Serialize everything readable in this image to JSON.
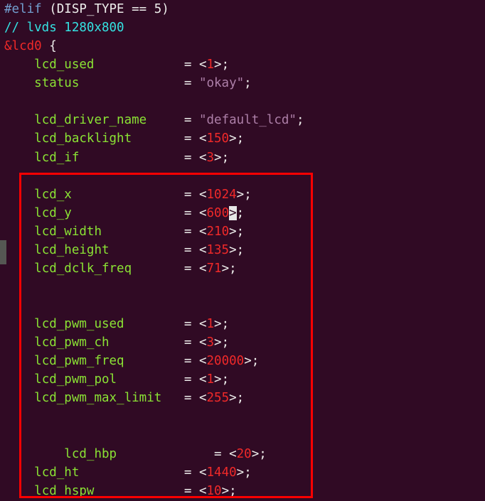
{
  "lines": [
    {
      "type": "directive",
      "key": "#elif",
      "cond": "(DISP_TYPE == 5)"
    },
    {
      "type": "comment",
      "text": "// lvds 1280x800"
    },
    {
      "type": "node",
      "node": "&lcd0",
      "tail": " {"
    },
    {
      "type": "propspace",
      "indent": "    ",
      "prop": "lcd_used",
      "padto": 24,
      "val": "1"
    },
    {
      "type": "propstr",
      "indent": "    ",
      "prop": "status",
      "padto": 24,
      "str": "\"okay\""
    },
    {
      "type": "blank"
    },
    {
      "type": "propstr",
      "indent": "    ",
      "prop": "lcd_driver_name",
      "padto": 24,
      "str": "\"default_lcd\""
    },
    {
      "type": "propspace",
      "indent": "    ",
      "prop": "lcd_backlight",
      "padto": 24,
      "val": "150"
    },
    {
      "type": "propspace",
      "indent": "    ",
      "prop": "lcd_if",
      "padto": 24,
      "val": "3"
    },
    {
      "type": "blank"
    },
    {
      "type": "propspace",
      "indent": "    ",
      "prop": "lcd_x",
      "padto": 24,
      "val": "1024"
    },
    {
      "type": "propcursor",
      "indent": "    ",
      "prop": "lcd_y",
      "padto": 24,
      "val": "600"
    },
    {
      "type": "propspace",
      "indent": "    ",
      "prop": "lcd_width",
      "padto": 24,
      "val": "210"
    },
    {
      "type": "propspace",
      "indent": "    ",
      "prop": "lcd_height",
      "padto": 24,
      "val": "135"
    },
    {
      "type": "propspace",
      "indent": "    ",
      "prop": "lcd_dclk_freq",
      "padto": 24,
      "val": "71"
    },
    {
      "type": "blank"
    },
    {
      "type": "blank"
    },
    {
      "type": "propspace",
      "indent": "    ",
      "prop": "lcd_pwm_used",
      "padto": 24,
      "val": "1"
    },
    {
      "type": "propspace",
      "indent": "    ",
      "prop": "lcd_pwm_ch",
      "padto": 24,
      "val": "3"
    },
    {
      "type": "propspace",
      "indent": "    ",
      "prop": "lcd_pwm_freq",
      "padto": 24,
      "val": "20000"
    },
    {
      "type": "propspace",
      "indent": "    ",
      "prop": "lcd_pwm_pol",
      "padto": 24,
      "val": "1"
    },
    {
      "type": "propspace",
      "indent": "    ",
      "prop": "lcd_pwm_max_limit",
      "padto": 24,
      "val": "255"
    },
    {
      "type": "blank"
    },
    {
      "type": "blank"
    },
    {
      "type": "propspace",
      "indent": "        ",
      "prop": "lcd_hbp",
      "padto": 28,
      "val": "20"
    },
    {
      "type": "propspace",
      "indent": "    ",
      "prop": "lcd_ht",
      "padto": 24,
      "val": "1440"
    },
    {
      "type": "propspace",
      "indent": "    ",
      "prop": "lcd_hspw",
      "padto": 24,
      "val": "10"
    }
  ]
}
